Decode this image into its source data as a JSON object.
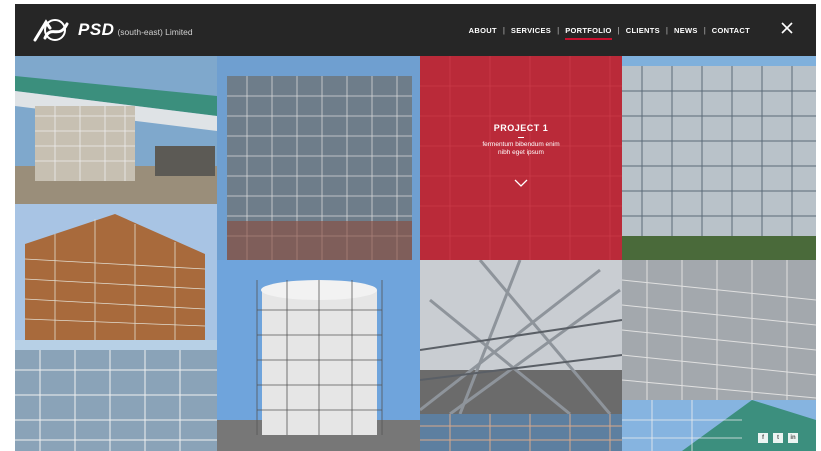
{
  "brand": {
    "name": "PSD",
    "sub": "(south-east) Limited",
    "logo_icon": "psd-logo-icon"
  },
  "nav": {
    "items": [
      {
        "label": "ABOUT"
      },
      {
        "label": "SERVICES"
      },
      {
        "label": "PORTFOLIO",
        "active": true
      },
      {
        "label": "CLIENTS"
      },
      {
        "label": "NEWS"
      },
      {
        "label": "CONTACT"
      }
    ],
    "separator": "|",
    "close_icon": "close-icon"
  },
  "project": {
    "title": "PROJECT 1",
    "description": "fermentum bibendum enim nibh eget ipsum",
    "chevron_icon": "chevron-down-icon"
  },
  "social": {
    "facebook": "f",
    "twitter": "t",
    "linkedin": "in"
  },
  "colors": {
    "accent": "#c8102e",
    "header": "#262626"
  }
}
